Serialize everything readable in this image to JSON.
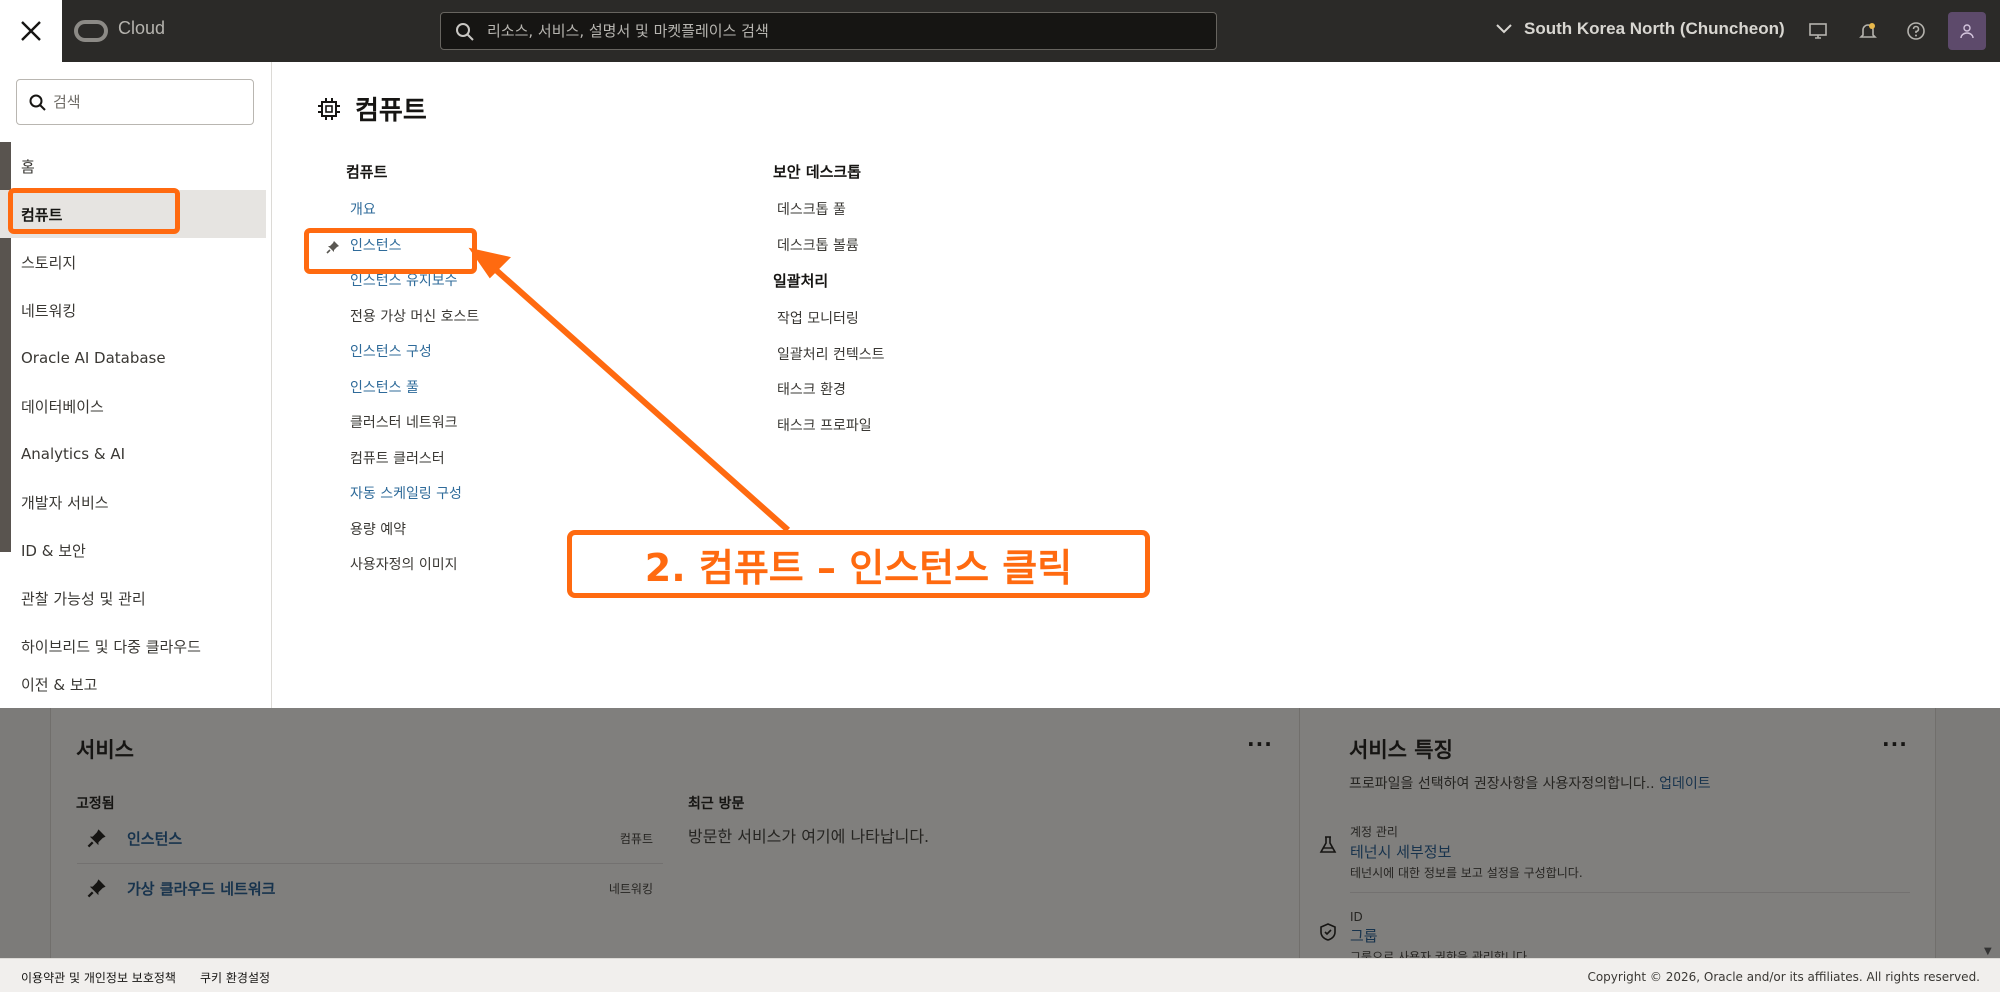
{
  "topbar": {
    "brand": "Cloud",
    "search_placeholder": "리소스, 서비스, 설명서 및 마켓플레이스 검색",
    "region": "South Korea North (Chuncheon)"
  },
  "sidebar": {
    "search_placeholder": "검색",
    "items": [
      {
        "label": "홈"
      },
      {
        "label": "컴퓨트"
      },
      {
        "label": "스토리지"
      },
      {
        "label": "네트워킹"
      },
      {
        "label": "Oracle AI Database"
      },
      {
        "label": "데이터베이스"
      },
      {
        "label": "Analytics & AI"
      },
      {
        "label": "개발자 서비스"
      },
      {
        "label": "ID & 보안"
      },
      {
        "label": "관찰 가능성 및 관리"
      },
      {
        "label": "하이브리드 및 다중 클라우드"
      },
      {
        "label": "이전 & 보고"
      }
    ]
  },
  "main": {
    "title": "컴퓨트",
    "col1": {
      "heading": "컴퓨트",
      "links": [
        {
          "label": "개요"
        },
        {
          "label": "인스턴스"
        },
        {
          "label": "인스턴스 유지보수"
        },
        {
          "label": "전용 가상 머신 호스트"
        },
        {
          "label": "인스턴스 구성"
        },
        {
          "label": "인스턴스 풀"
        },
        {
          "label": "클러스터 네트워크"
        },
        {
          "label": "컴퓨트 클러스터"
        },
        {
          "label": "자동 스케일링 구성"
        },
        {
          "label": "용량 예약"
        },
        {
          "label": "사용자정의 이미지"
        }
      ]
    },
    "col2": {
      "heading1": "보안 데스크톱",
      "links1": [
        {
          "label": "데스크톱 풀"
        },
        {
          "label": "데스크톱 볼륨"
        }
      ],
      "heading2": "일괄처리",
      "links2": [
        {
          "label": "작업 모니터링"
        },
        {
          "label": "일괄처리 컨텍스트"
        },
        {
          "label": "태스크 환경"
        },
        {
          "label": "태스크 프로파일"
        }
      ]
    }
  },
  "services": {
    "title": "서비스",
    "menu": "···",
    "pinned_heading": "고정됨",
    "pinned": [
      {
        "name": "인스턴스",
        "category": "컴퓨트"
      },
      {
        "name": "가상 클라우드 네트워크",
        "category": "네트워킹"
      }
    ],
    "recent_heading": "최근 방문",
    "recent_empty": "방문한 서비스가 여기에 나타납니다."
  },
  "features": {
    "title": "서비스 특징",
    "menu": "···",
    "desc": "프로파일을 선택하여 권장사항을 사용자정의합니다..",
    "desc_link": "업데이트",
    "items": [
      {
        "category": "계정 관리",
        "name": "테넌시 세부정보",
        "desc": "테넌시에 대한 정보를 보고 설정을 구성합니다."
      },
      {
        "category": "ID",
        "name": "그룹",
        "desc": "그룹으로 사용자 권한을 관리합니다."
      }
    ]
  },
  "footer": {
    "terms": "이용약관 및 개인정보 보호정책",
    "cookies": "쿠키 환경설정",
    "copyright": "Copyright © 2026, Oracle and/or its affiliates. All rights reserved."
  },
  "annotation": {
    "callout": "2. 컴퓨트 – 인스턴스 클릭",
    "color": "#ff6a10"
  }
}
